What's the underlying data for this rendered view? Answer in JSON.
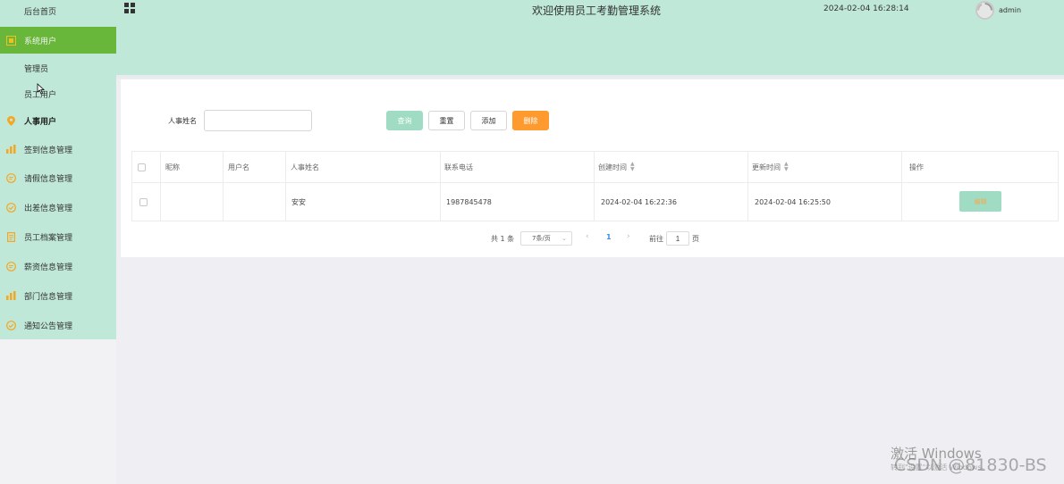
{
  "header": {
    "title": "欢迎使用员工考勤管理系统",
    "datetime": "2024-02-04 16:28:14",
    "username": "admin"
  },
  "sidebar": {
    "items": [
      {
        "label": "后台首页"
      },
      {
        "label": "系统用户"
      },
      {
        "label": "管理员"
      },
      {
        "label": "员工用户"
      },
      {
        "label": "人事用户"
      },
      {
        "label": "签到信息管理"
      },
      {
        "label": "请假信息管理"
      },
      {
        "label": "出差信息管理"
      },
      {
        "label": "员工档案管理"
      },
      {
        "label": "薪资信息管理"
      },
      {
        "label": "部门信息管理"
      },
      {
        "label": "通知公告管理"
      }
    ]
  },
  "search": {
    "label": "人事姓名",
    "value": "",
    "placeholder": ""
  },
  "toolbar": {
    "query_label": "查询",
    "reset_label": "重置",
    "add_label": "添加",
    "delete_label": "删除"
  },
  "table": {
    "columns": [
      "昵称",
      "用户名",
      "人事姓名",
      "联系电话",
      "创建时间",
      "更新时间",
      "操作"
    ],
    "rows": [
      {
        "nickname": "",
        "username": "",
        "name": "安安",
        "phone": "1987845478",
        "created": "2024-02-04 16:22:36",
        "updated": "2024-02-04 16:25:50",
        "action": "编辑"
      }
    ]
  },
  "pagination": {
    "total_text": "共 1 条",
    "page_size": "7条/页",
    "prev": "‹",
    "next": "›",
    "current_page": "1",
    "goto_label": "前往",
    "goto_value": "1",
    "page_suffix": "页"
  },
  "watermark": {
    "line1": "激活 Windows",
    "line2": "转到\"设置\"以激活 Windows。",
    "line3": "CSDN @81830-BS"
  },
  "colors": {
    "sidebar_bg": "#bfe8d8",
    "active_item": "#68b63a",
    "accent_orange": "#ff9a2e",
    "query_green": "#9fdcc3",
    "icon_orange": "#f5a623"
  }
}
